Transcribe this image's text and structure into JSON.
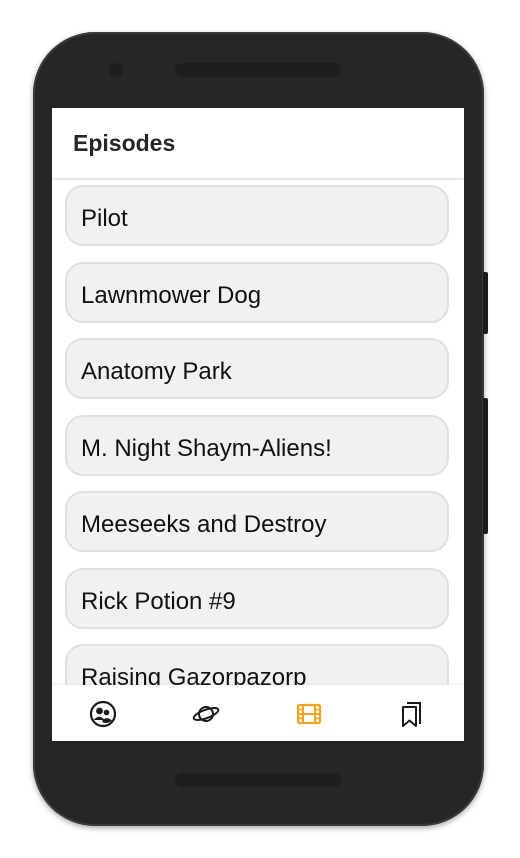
{
  "app_bar": {
    "title": "Episodes"
  },
  "episodes": [
    {
      "title": "Pilot"
    },
    {
      "title": "Lawnmower Dog"
    },
    {
      "title": "Anatomy Park"
    },
    {
      "title": "M. Night Shaym-Aliens!"
    },
    {
      "title": "Meeseeks and Destroy"
    },
    {
      "title": "Rick Potion #9"
    },
    {
      "title": "Raising Gazorpazorp"
    }
  ],
  "bottom_nav": {
    "items": [
      {
        "icon": "characters-icon",
        "selected": false
      },
      {
        "icon": "planet-icon",
        "selected": false
      },
      {
        "icon": "film-icon",
        "selected": true
      },
      {
        "icon": "bookmarks-icon",
        "selected": false
      }
    ],
    "active_color": "#f5a31a",
    "inactive_color": "#1a1a1a"
  }
}
